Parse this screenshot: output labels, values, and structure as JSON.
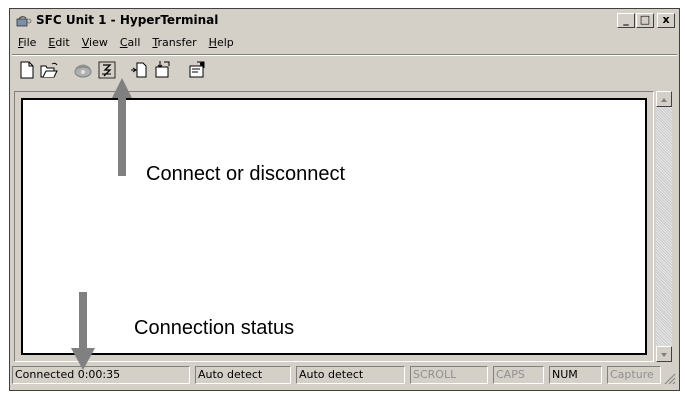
{
  "window": {
    "title": "SFC Unit 1 - HyperTerminal",
    "controls": {
      "minimize": "_",
      "maximize": "□",
      "close": "x"
    }
  },
  "menu": [
    {
      "label_pre": "",
      "label_u": "F",
      "label_post": "ile"
    },
    {
      "label_pre": "",
      "label_u": "E",
      "label_post": "dit"
    },
    {
      "label_pre": "",
      "label_u": "V",
      "label_post": "iew"
    },
    {
      "label_pre": "",
      "label_u": "C",
      "label_post": "all"
    },
    {
      "label_pre": "",
      "label_u": "T",
      "label_post": "ransfer"
    },
    {
      "label_pre": "",
      "label_u": "H",
      "label_post": "elp"
    }
  ],
  "toolbar": [
    "new-document-icon",
    "open-folder-icon",
    "dial-icon",
    "disconnect-icon",
    "send-file-icon",
    "receive-file-icon",
    "properties-icon"
  ],
  "status": {
    "connection": "Connected 0:00:35",
    "detect1": "Auto detect",
    "detect2": "Auto detect",
    "scroll": "SCROLL",
    "caps": "CAPS",
    "num": "NUM",
    "capture": "Capture"
  },
  "annotations": {
    "connect": "Connect or disconnect",
    "status": "Connection status"
  },
  "colors": {
    "face": "#d4d0c8",
    "arrow": "#808080"
  }
}
